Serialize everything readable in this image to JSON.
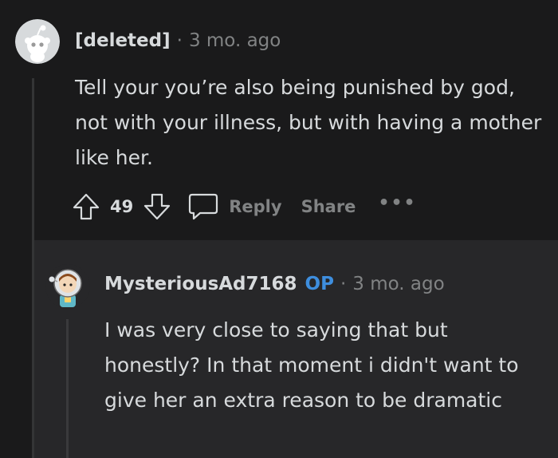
{
  "comment": {
    "author": "[deleted]",
    "separator": "·",
    "time": "3 mo. ago",
    "body": "Tell your you’re also being punished by god, not with your illness, but with having a mother like her.",
    "avatar_icon": "reddit-snoo-icon",
    "actions": {
      "upvote_icon": "arrow-up-icon",
      "votes": "49",
      "downvote_icon": "arrow-down-icon",
      "reply_icon": "chat-bubble-icon",
      "reply_label": "Reply",
      "share_label": "Share",
      "more_label": "•••"
    }
  },
  "reply": {
    "author": "MysteriousAd7168",
    "op_badge": "OP",
    "separator": "·",
    "time": "3 mo. ago",
    "body": "I was very close to saying that but honestly? In that moment i didn't want to give her an extra reason to be dramatic",
    "avatar_icon": "astronaut-avatar-icon"
  },
  "colors": {
    "background": "#1a1a1b",
    "reply_background": "#272729",
    "text": "#d7dadc",
    "muted": "#818384",
    "op": "#3e8ede"
  }
}
